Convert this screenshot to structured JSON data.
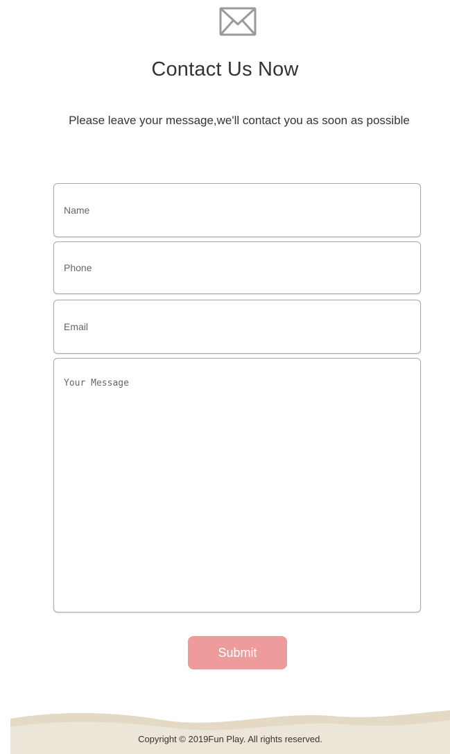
{
  "header": {
    "icon": "envelope-icon",
    "title": "Contact Us Now",
    "subtitle": "Please leave your message,we'll contact you as soon as possible"
  },
  "form": {
    "name_placeholder": "Name",
    "phone_placeholder": "Phone",
    "email_placeholder": "Email",
    "message_placeholder": "Your Message",
    "submit_label": "Submit"
  },
  "footer": {
    "copyright": "Copyright © 2019Fun Play. All rights reserved."
  },
  "colors": {
    "accent": "#ee9b9b",
    "footer_bg": "#ece6d8",
    "footer_wave": "#e3d9c4"
  }
}
